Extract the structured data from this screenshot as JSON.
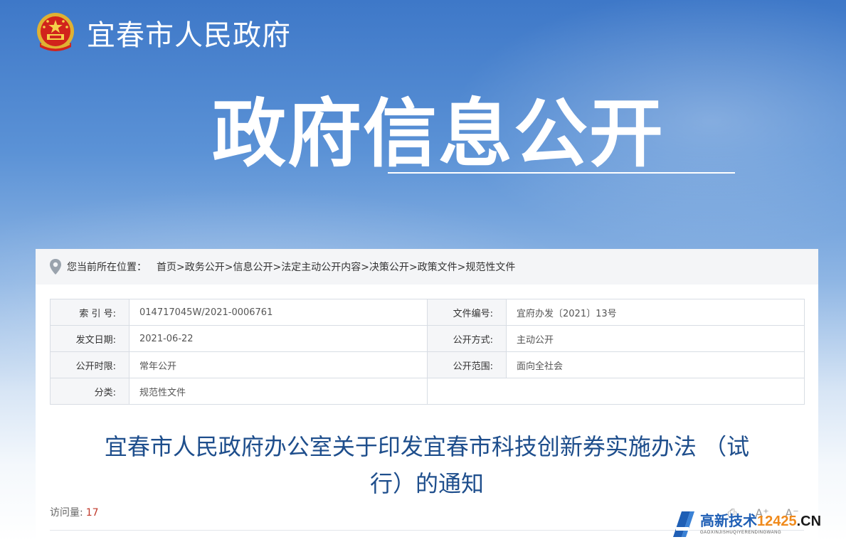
{
  "header": {
    "site_title": "宜春市人民政府",
    "hero_title": "政府信息公开"
  },
  "breadcrumb": {
    "prefix": "您当前所在位置：",
    "items": [
      "首页",
      "政务公开",
      "信息公开",
      "法定主动公开内容",
      "决策公开",
      "政策文件",
      "规范性文件"
    ],
    "separator": ">"
  },
  "meta": {
    "rows": [
      {
        "k1": "索 引 号:",
        "v1": "014717045W/2021-0006761",
        "k2": "文件编号:",
        "v2": "宜府办发〔2021〕13号"
      },
      {
        "k1": "发文日期:",
        "v1": "2021-06-22",
        "k2": "公开方式:",
        "v2": "主动公开"
      },
      {
        "k1": "公开时限:",
        "v1": "常年公开",
        "k2": "公开范围:",
        "v2": "面向全社会"
      },
      {
        "k1": "分类:",
        "v1": "规范性文件",
        "k2": "",
        "v2": ""
      }
    ]
  },
  "document": {
    "title_line1": "宜春市人民政府办公室关于印发宜春市科技创新券实施办法 （试",
    "title_line2": "行）的通知",
    "visits_label": "访问量:",
    "visits_count": "17"
  },
  "tools": {
    "print_glyph": "⎙",
    "font_up": "A⁺",
    "font_down": "A⁻"
  },
  "watermark": {
    "brand": "高新技术",
    "number": "12425",
    "domain": ".CN",
    "pinyin": "GAOXINJISHUQIYERENDINGWANG"
  },
  "colors": {
    "title_blue": "#1e4e8c",
    "visits_red": "#c0392b",
    "banner_top": "#3e78c8"
  }
}
